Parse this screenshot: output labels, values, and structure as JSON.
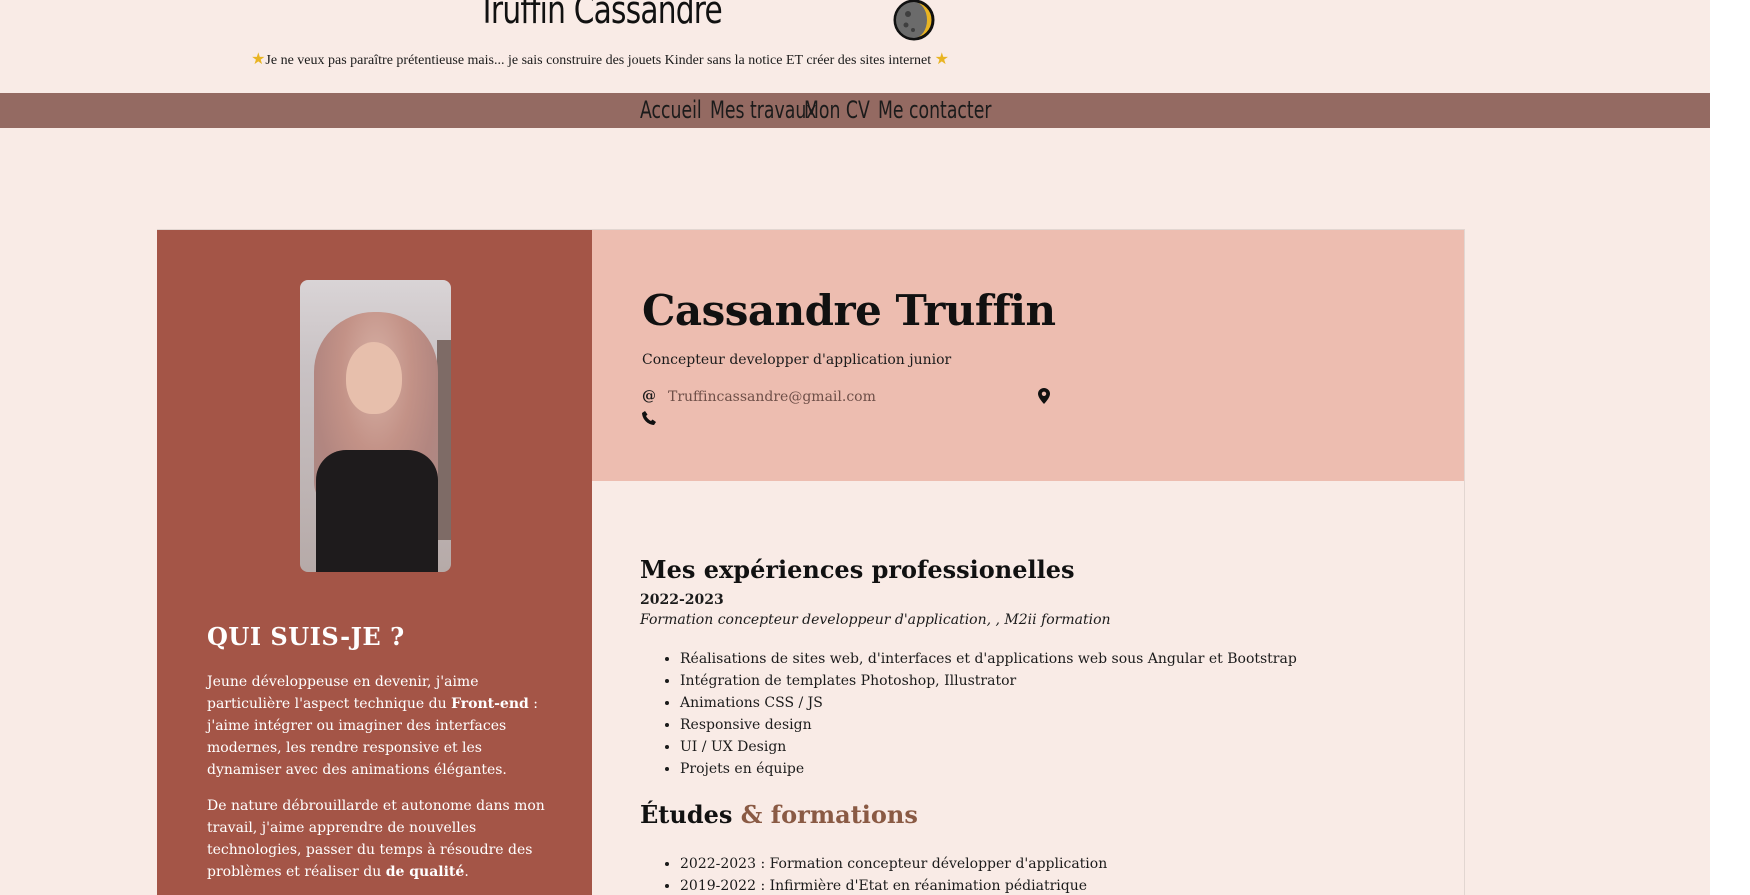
{
  "header": {
    "site_title": "Truffin Cassandre",
    "tagline": "Je ne veux pas paraître prétentieuse mais... je sais construire des jouets Kinder sans la notice ET créer des sites internet",
    "tagline_icon": "star-icon",
    "title_icon": "moon-icon"
  },
  "nav": {
    "items": [
      "Accueil",
      "Mes travaux",
      "Mon CV",
      "Me contacter"
    ]
  },
  "profile": {
    "heading": "QUI SUIS-JE ?",
    "p1_start": "Jeune développeuse en devenir, j'aime particulière l'aspect technique du ",
    "p1_bold": "Front-end",
    "p1_end": " : j'aime intégrer ou imaginer des interfaces modernes, les rendre responsive et les dynamiser avec des animations élégantes.",
    "p2_start": "De nature débrouillarde et autonome dans mon travail, j'aime apprendre de nouvelles technologies, passer du temps à résoudre des problèmes et réaliser du ",
    "p2_bold": "de qualité",
    "p2_end": "."
  },
  "cv_header": {
    "name": "Cassandre Truffin",
    "role": "Concepteur developper d'application junior",
    "email": "Truffincassandre@gmail.com",
    "at_symbol": "@"
  },
  "experience": {
    "title": "Mes expériences professionelles",
    "year": "2022-2023",
    "subtitle": "Formation concepteur developpeur d'application, , M2ii formation",
    "items": [
      "Réalisations de sites web, d'interfaces et d'applications web sous Angular et Bootstrap",
      "Intégration de templates Photoshop, Illustrator",
      "Animations CSS / JS",
      "Responsive design",
      "UI / UX Design",
      "Projets en équipe"
    ]
  },
  "education": {
    "title_main": "Études",
    "title_accent": " & formations",
    "items": [
      "2022-2023 : Formation concepteur développer d'application",
      "2019-2022 : Infirmière d'Etat en réanimation pédiatrique"
    ]
  },
  "colors": {
    "page_bg": "#f9ebe6",
    "nav_bg": "#946a62",
    "sidebar_bg": "#a45547",
    "header_card_bg": "#edbdb0",
    "accent_text": "#8a5a44"
  }
}
